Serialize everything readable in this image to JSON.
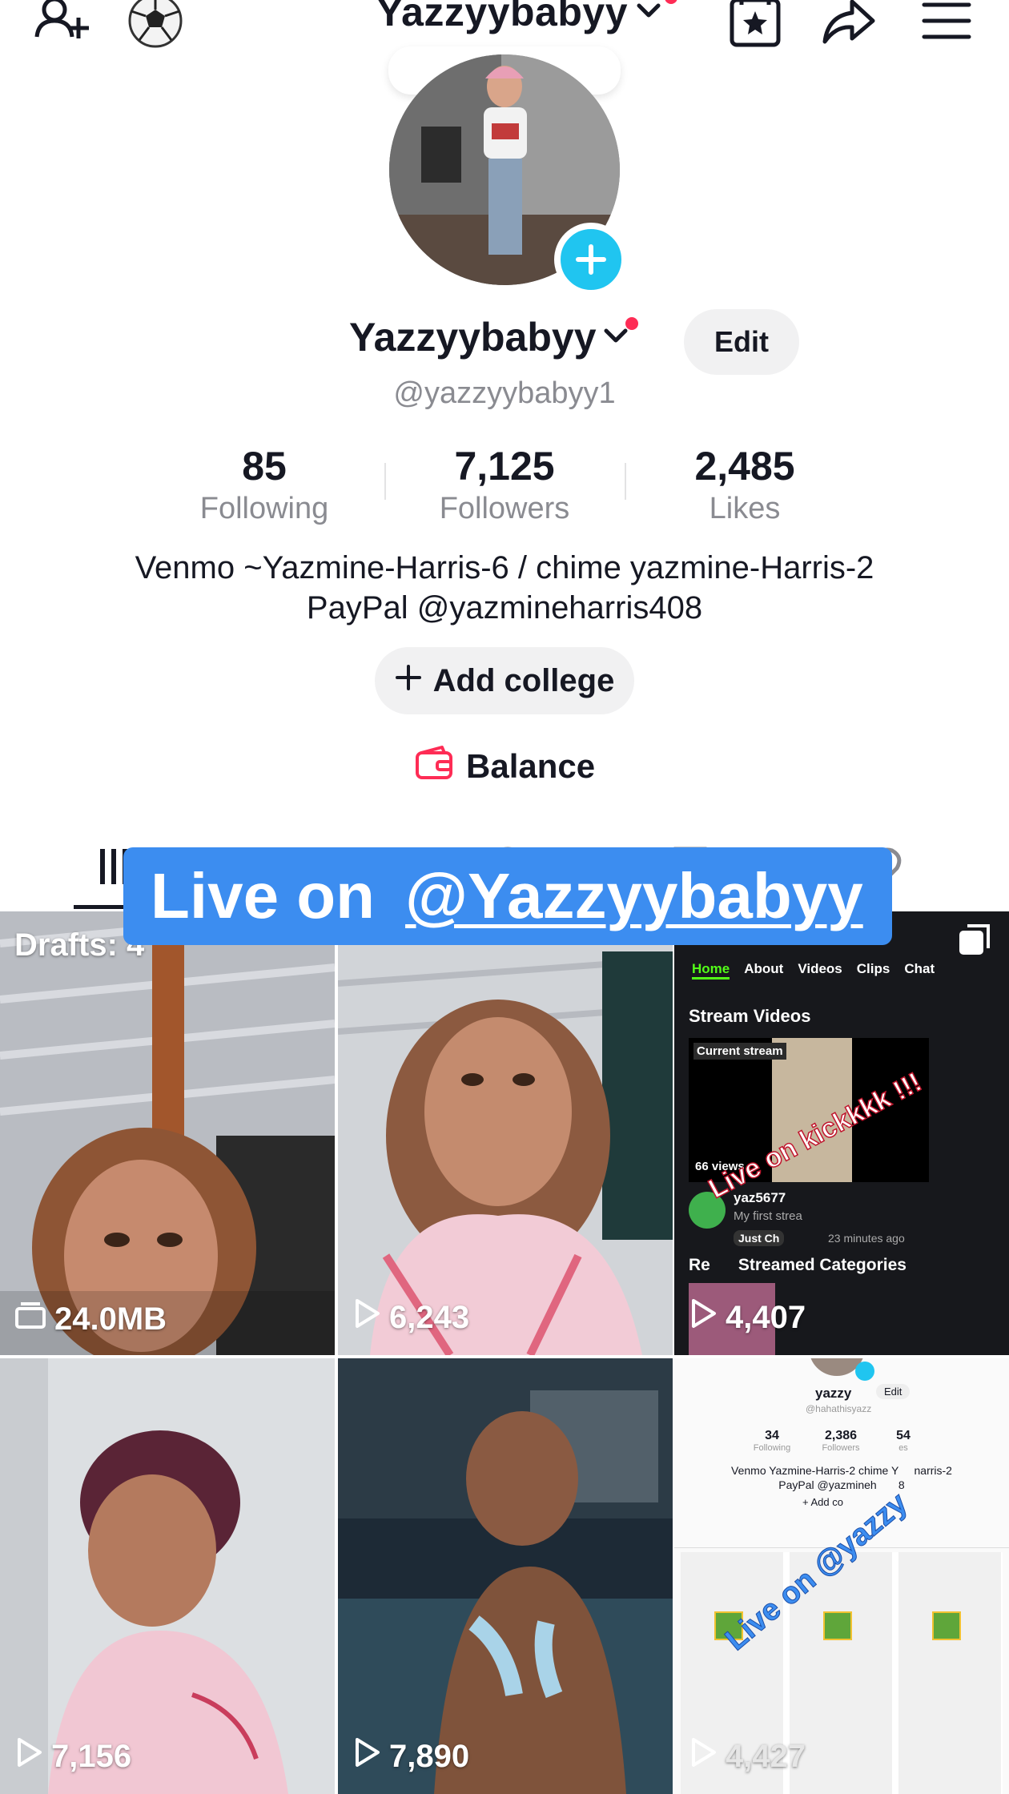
{
  "header": {
    "title": "Yazzyybabyy",
    "icons": [
      "add-friend-icon",
      "soccer-ball-icon",
      "chevron-down-icon",
      "favorites-icon",
      "share-icon",
      "menu-icon"
    ]
  },
  "profile": {
    "name": "Yazzyybabyy",
    "edit_label": "Edit",
    "handle": "@yazzyybabyy1",
    "stats": [
      {
        "value": "85",
        "label": "Following"
      },
      {
        "value": "7,125",
        "label": "Followers"
      },
      {
        "value": "2,485",
        "label": "Likes"
      }
    ],
    "bio_line1": "Venmo ~Yazmine-Harris-6 / chime yazmine-Harris-2",
    "bio_line2": "PayPal @yazmineharris408",
    "add_college_label": "Add college",
    "balance_label": "Balance"
  },
  "tabs": [
    "videos-tab",
    "reposts-tab",
    "private-tab",
    "saved-tab",
    "liked-tab"
  ],
  "live_banner": {
    "prefix": "Live on",
    "handle": "@Yazzyybabyy"
  },
  "grid": {
    "drafts_label": "Drafts: 4",
    "items": [
      {
        "label": "24.0MB",
        "kind": "drafts"
      },
      {
        "label": "6,243",
        "kind": "views"
      },
      {
        "label": "4,407",
        "kind": "views"
      },
      {
        "label": "7,156",
        "kind": "views"
      },
      {
        "label": "7,890",
        "kind": "views"
      },
      {
        "label": "4,427",
        "kind": "views"
      }
    ],
    "stream_cell": {
      "nav": [
        "Home",
        "About",
        "Videos",
        "Clips",
        "Chat"
      ],
      "stream_videos": "Stream Videos",
      "current_stream": "Current stream",
      "views": "66 views",
      "user": "yaz5677",
      "subtitle": "My first strea",
      "just_chatting": "Just Ch",
      "time_ago": "23 minutes ago",
      "categories": "Re      Streamed Categories",
      "overlay": "Live on kickkkk !!!"
    },
    "profile_cell": {
      "name": "yazzy",
      "edit": "Edit",
      "handle": "@hahathisyazz",
      "stats": [
        {
          "value": "34",
          "label": "Following"
        },
        {
          "value": "2,386",
          "label": "Followers"
        },
        {
          "value": "54",
          "label": "es"
        }
      ],
      "bio1": "Venmo Yazmine-Harris-2 chime Y     narris-2",
      "bio2": "PayPal @yazmineh       8",
      "add_college": "+ Add co",
      "overlay": "Live on @yazzy"
    }
  }
}
